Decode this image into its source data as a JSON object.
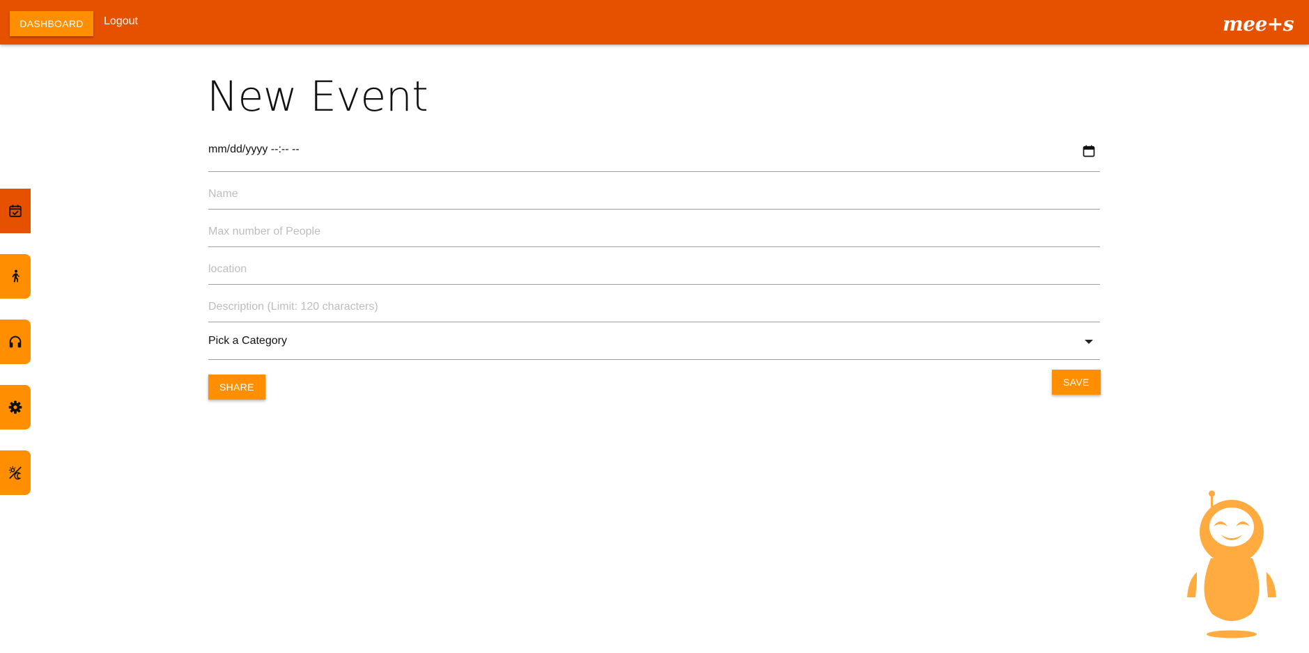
{
  "topbar": {
    "dashboard_label": "DASHBOARD",
    "logout_label": "Logout",
    "logo_text": "mee+s"
  },
  "sidebar": {
    "items": [
      {
        "icon": "calendar-check-icon",
        "active": true
      },
      {
        "icon": "person-icon",
        "active": false
      },
      {
        "icon": "headphones-icon",
        "active": false
      },
      {
        "icon": "gear-icon",
        "active": false
      },
      {
        "icon": "theme-toggle-icon",
        "active": false
      }
    ]
  },
  "form": {
    "title": "New Event",
    "datetime_value": "mm/dd/yyyy --:-- --",
    "name_placeholder": "Name",
    "max_people_placeholder": "Max number of People",
    "location_placeholder": "location",
    "description_placeholder": "Description (Limit: 120 characters)",
    "category_selected": "Pick a Category",
    "share_label": "SHARE",
    "save_label": "SAVE"
  },
  "colors": {
    "primary_dark": "#e65100",
    "accent": "#ff8f00",
    "mascot": "#ffab40"
  }
}
